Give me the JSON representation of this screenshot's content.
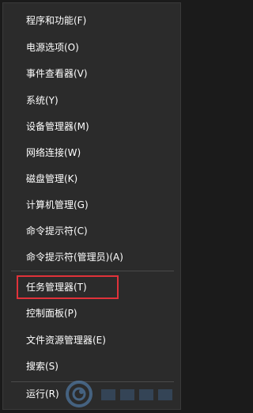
{
  "menu": {
    "items": [
      {
        "label": "程序和功能(F)"
      },
      {
        "label": "电源选项(O)"
      },
      {
        "label": "事件查看器(V)"
      },
      {
        "label": "系统(Y)"
      },
      {
        "label": "设备管理器(M)"
      },
      {
        "label": "网络连接(W)"
      },
      {
        "label": "磁盘管理(K)"
      },
      {
        "label": "计算机管理(G)"
      },
      {
        "label": "命令提示符(C)"
      },
      {
        "label": "命令提示符(管理员)(A)"
      },
      {
        "label": "任务管理器(T)"
      },
      {
        "label": "控制面板(P)"
      },
      {
        "label": "文件资源管理器(E)"
      },
      {
        "label": "搜索(S)"
      },
      {
        "label": "运行(R)"
      }
    ]
  },
  "highlight": {
    "color": "#e0323a",
    "target": "任务管理器(T)"
  },
  "watermark": {
    "icon": "swirl-logo-icon"
  }
}
